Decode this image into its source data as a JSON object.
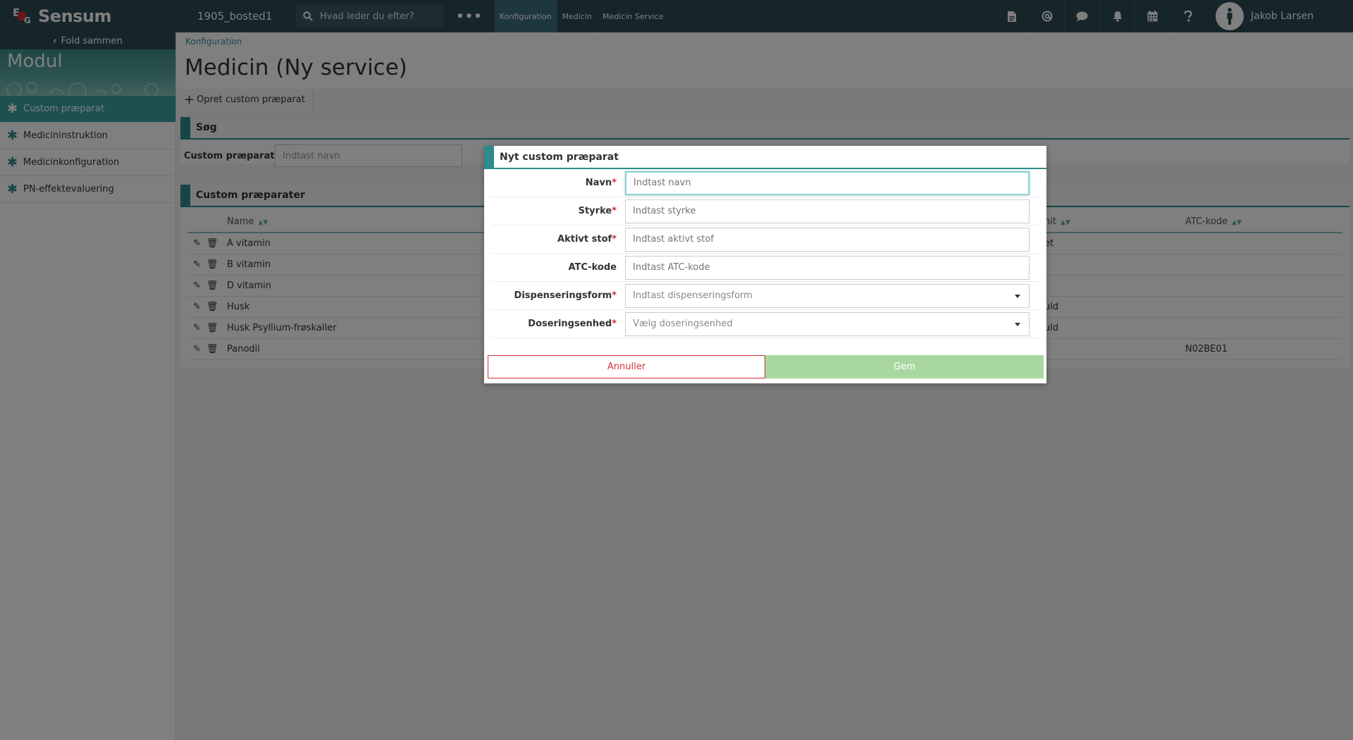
{
  "app": {
    "brand": "Sensum",
    "tenant": "1905_bosted1"
  },
  "search": {
    "placeholder": "Hvad leder du efter?"
  },
  "nav": {
    "more": "•••",
    "tabs": [
      "Konfiguration",
      "Medicin",
      "Medicin Service"
    ]
  },
  "topicons": [
    "document-icon",
    "at-icon",
    "chat-icon",
    "bell-icon",
    "calendar-icon",
    "help-icon"
  ],
  "user": {
    "name": "Jakob Larsen"
  },
  "sidebar": {
    "collapse": "Fold sammen",
    "title": "Modul",
    "items": [
      {
        "label": "Custom præparat",
        "active": true
      },
      {
        "label": "Medicininstruktion"
      },
      {
        "label": "Medicinkonfiguration"
      },
      {
        "label": "PN-effektevaluering"
      }
    ]
  },
  "page": {
    "breadcrumb": "Konfiguration",
    "title": "Medicin (Ny service)",
    "create_button": "Opret custom præparat",
    "search_panel": {
      "title": "Søg",
      "label": "Custom præparat",
      "placeholder": "Indtast navn"
    },
    "list_panel": {
      "title": "Custom præparater",
      "columns": [
        "Name",
        "nit",
        "ATC-kode"
      ],
      "rows": [
        {
          "name": "A vitamin",
          "unit": "et",
          "atc": ""
        },
        {
          "name": "B vitamin",
          "unit": "",
          "atc": ""
        },
        {
          "name": "D vitamin",
          "unit": "",
          "atc": ""
        },
        {
          "name": "Husk",
          "unit": "uld",
          "atc": ""
        },
        {
          "name": "Husk Psyllium-frøskaller",
          "unit": "uld",
          "atc": ""
        },
        {
          "name": "Panodil",
          "unit": "",
          "atc": "N02BE01"
        }
      ]
    }
  },
  "modal": {
    "title": "Nyt custom præparat",
    "fields": [
      {
        "label": "Navn",
        "required": true,
        "placeholder": "Indtast navn",
        "type": "text"
      },
      {
        "label": "Styrke",
        "required": true,
        "placeholder": "Indtast styrke",
        "type": "text"
      },
      {
        "label": "Aktivt stof",
        "required": true,
        "placeholder": "Indtast aktivt stof",
        "type": "text"
      },
      {
        "label": "ATC-kode",
        "required": false,
        "placeholder": "Indtast ATC-kode",
        "type": "text"
      },
      {
        "label": "Dispenseringsform",
        "required": true,
        "placeholder": "Indtast dispenseringsform",
        "type": "select"
      },
      {
        "label": "Doseringsenhed",
        "required": true,
        "placeholder": "Vælg doseringsenhed",
        "type": "select"
      }
    ],
    "cancel": "Annuller",
    "save": "Gem",
    "required_marker": "*"
  },
  "colors": {
    "topbar": "#2b4a55",
    "accent": "#2e8b8a",
    "danger": "#d0303a",
    "save_disabled": "#a8d8a0"
  }
}
